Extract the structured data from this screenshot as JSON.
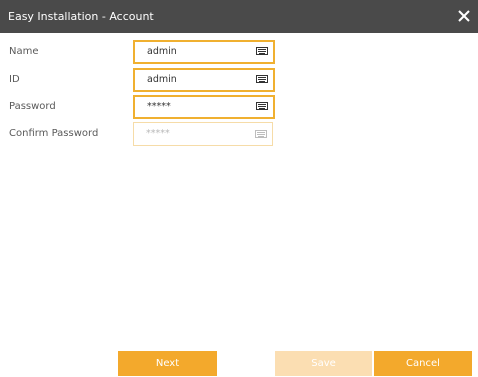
{
  "window": {
    "title": "Easy Installation - Account",
    "close_icon": "close-icon"
  },
  "form": {
    "fields": [
      {
        "label": "Name",
        "value": "admin",
        "icon": "keyboard-icon",
        "enabled": true
      },
      {
        "label": "ID",
        "value": "admin",
        "icon": "keyboard-icon",
        "enabled": true
      },
      {
        "label": "Password",
        "value": "*****",
        "icon": "keyboard-icon",
        "enabled": true
      },
      {
        "label": "Confirm Password",
        "value": "*****",
        "icon": "keyboard-icon",
        "enabled": false
      }
    ]
  },
  "buttons": {
    "next": "Next",
    "save": "Save",
    "cancel": "Cancel"
  },
  "colors": {
    "titlebar": "#4a4a4a",
    "accent": "#f3a92c",
    "accent_disabled": "#fbdeb2"
  }
}
